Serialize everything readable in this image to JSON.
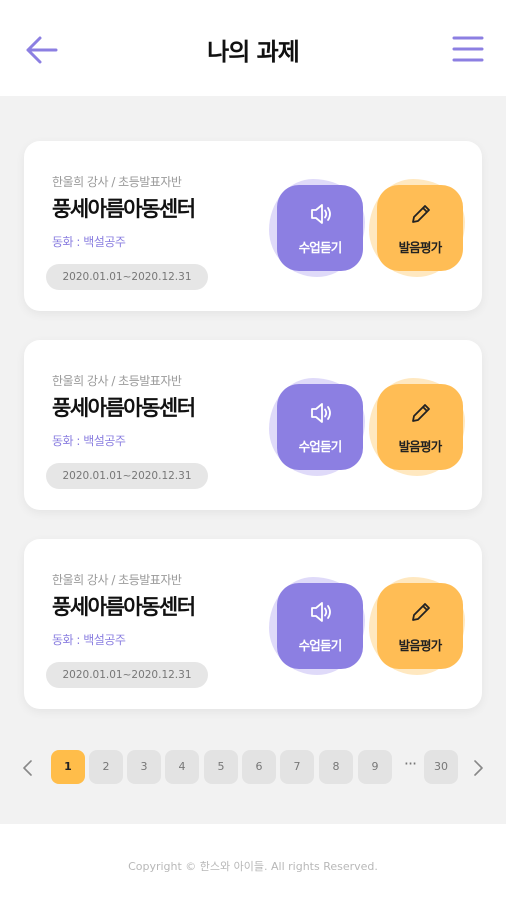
{
  "header": {
    "title": "나의 과제",
    "back_icon": "arrow-left-icon",
    "menu_icon": "hamburger-menu-icon",
    "accent_color": "#8c7fe2"
  },
  "assignments": [
    {
      "teacher_class": "한울희 강사 / 초등발표자반",
      "center": "풍세아름아동센터",
      "book": "동화 : 백설공주",
      "period": "2020.01.01~2020.12.31",
      "listen_label": "수업듣기",
      "evaluate_label": "발음평가"
    },
    {
      "teacher_class": "한울희 강사 / 초등발표자반",
      "center": "풍세아름아동센터",
      "book": "동화 : 백설공주",
      "period": "2020.01.01~2020.12.31",
      "listen_label": "수업듣기",
      "evaluate_label": "발음평가"
    },
    {
      "teacher_class": "한울희 강사 / 초등발표자반",
      "center": "풍세아름아동센터",
      "book": "동화 : 백설공주",
      "period": "2020.01.01~2020.12.31",
      "listen_label": "수업듣기",
      "evaluate_label": "발음평가"
    }
  ],
  "action_colors": {
    "listen": "#8c7fe2",
    "evaluate": "#ffbd55"
  },
  "pagination": {
    "current": "1",
    "pages": [
      "1",
      "2",
      "3",
      "4",
      "5",
      "6",
      "7",
      "8",
      "9"
    ],
    "ellipsis": "···",
    "last": "30",
    "prev_icon": "chevron-left-icon",
    "next_icon": "chevron-right-icon"
  },
  "footer": {
    "copyright": "Copyright © 한스와 아이들. All rights Reserved."
  }
}
